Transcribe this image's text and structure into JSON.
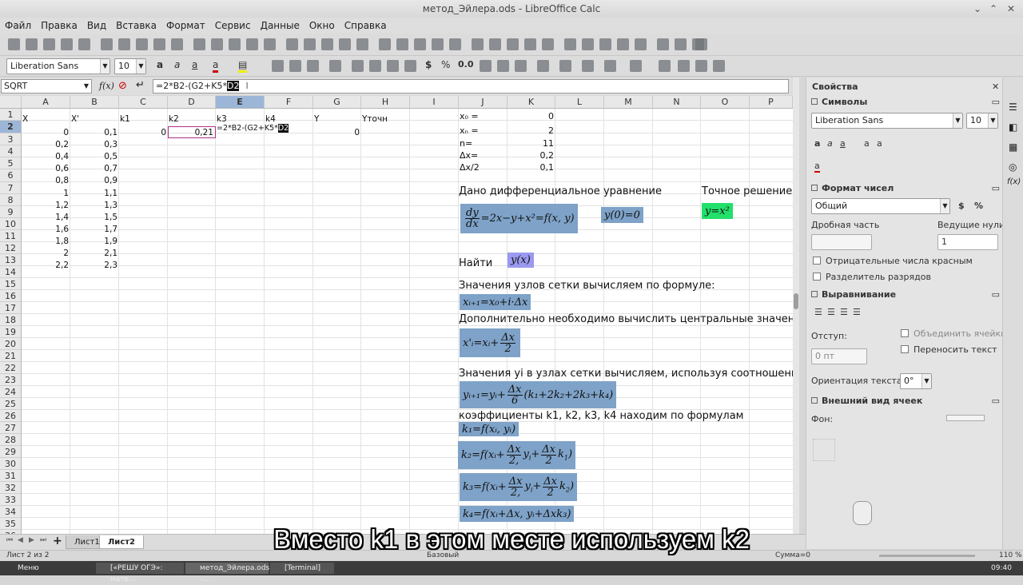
{
  "window": {
    "title": "метод_Эйлера.ods - LibreOffice Calc"
  },
  "menu": [
    "Файл",
    "Правка",
    "Вид",
    "Вставка",
    "Формат",
    "Сервис",
    "Данные",
    "Окно",
    "Справка"
  ],
  "font_toolbar": {
    "font_name": "Liberation Sans",
    "font_size": "10"
  },
  "formula_bar": {
    "name_box": "SQRT",
    "fx": "f(x)",
    "formula_before": "=2*B2-(G2+K5*",
    "formula_selected": "D2"
  },
  "columns": [
    "A",
    "B",
    "C",
    "D",
    "E",
    "F",
    "G",
    "H",
    "I",
    "J",
    "K",
    "L",
    "M",
    "N",
    "O",
    "P"
  ],
  "rows": [
    "1",
    "2",
    "3",
    "4",
    "5",
    "6",
    "7",
    "8",
    "9",
    "10",
    "11",
    "12",
    "13",
    "14",
    "15",
    "16",
    "17",
    "18",
    "19",
    "20",
    "21",
    "22",
    "23",
    "24",
    "25",
    "26",
    "27",
    "28",
    "29",
    "30",
    "31",
    "32",
    "33",
    "34",
    "35",
    "36",
    "37"
  ],
  "headers": {
    "a": "X",
    "b": "X'",
    "c": "k1",
    "d": "k2",
    "e": "k3",
    "f": "k4",
    "g": "Y",
    "h": "Yточн"
  },
  "col_a": [
    "0",
    "0,2",
    "0,4",
    "0,6",
    "0,8",
    "1",
    "1,2",
    "1,4",
    "1,6",
    "1,8",
    "2",
    "2,2"
  ],
  "col_b": [
    "0,1",
    "0,3",
    "0,5",
    "0,7",
    "0,9",
    "1,1",
    "1,3",
    "1,5",
    "1,7",
    "1,9",
    "2,1",
    "2,3"
  ],
  "row2": {
    "c": "0",
    "d": "0,21",
    "e_before": "=2*B2-(G2+K5*",
    "e_selected": "D2",
    "g": "0"
  },
  "params": [
    {
      "label": "x₀ =",
      "value": "0"
    },
    {
      "label": "xₙ =",
      "value": "2"
    },
    {
      "label": "n=",
      "value": "11"
    },
    {
      "label": "Δx=",
      "value": "0,2"
    },
    {
      "label": "Δx/2",
      "value": "0,1"
    }
  ],
  "annotations": {
    "given": "Дано дифференциальное уравнение",
    "exact": "Точное решение:",
    "find": "Найти",
    "nodes": "Значения узлов сетки вычисляем по формуле:",
    "central": "Дополнительно необходимо вычислить центральные значения",
    "yi": "Значения yi в узлах сетки вычисляем, используя соотношение",
    "coef": "коэффициенты k1, k2, k3, k4 находим по формулам"
  },
  "formulas": {
    "ode_rhs": "=2x−y+x²=f(x, y)",
    "init": "y(0)=0",
    "exact": "y=x²",
    "find": "y(x)",
    "node": "xᵢ₊₁=x₀+i·Δx",
    "central": "x'ᵢ=xᵢ+",
    "yi_lhs": "yᵢ₊₁=yᵢ+",
    "yi_rhs": "(k₁+2k₂+2k₃+k₄)",
    "k1": "k₁=f(xᵢ, yᵢ)",
    "k2": "k₂=f(xᵢ+",
    "k3": "k₃=f(xᵢ+",
    "k4": "k₄=f(xᵢ+Δx, yᵢ+Δxk₃)"
  },
  "sidebar": {
    "title": "Свойства",
    "characters": "Символы",
    "font": "Liberation Sans",
    "size": "10",
    "number_format": "Формат чисел",
    "category": "Общий",
    "decimal_places": "Дробная часть",
    "leading_zeros": "Ведущие нули:",
    "leading_zeros_value": "1",
    "negative_red": "Отрицательные числа красным",
    "thousands_sep": "Разделитель разрядов",
    "alignment": "Выравнивание",
    "indent": "Отступ:",
    "indent_value": "0 пт",
    "merge": "Объединить ячейки",
    "wrap": "Переносить текст",
    "orientation": "Ориентация текста:",
    "orientation_value": "0°",
    "cell_appearance": "Внешний вид ячеек",
    "background": "Фон:"
  },
  "sheet_tabs": [
    "Лист1",
    "Лист2"
  ],
  "status": {
    "sheet": "Лист 2 из 2",
    "style": "Базовый",
    "sum": "Сумма=0",
    "zoom": "110 %"
  },
  "taskbar": {
    "menu": "Меню",
    "task1": "[«РЕШУ ОГЭ»: мате...",
    "task2": "метод_Эйлера.ods -...",
    "task3": "[Terminal]",
    "clock": "09:40"
  },
  "subtitle": "Вместо k1 в этом месте используем k2",
  "colors": {
    "formula_box": "#7ea2c8",
    "exact_box": "#22e06a",
    "find_box": "#9a9af0"
  }
}
